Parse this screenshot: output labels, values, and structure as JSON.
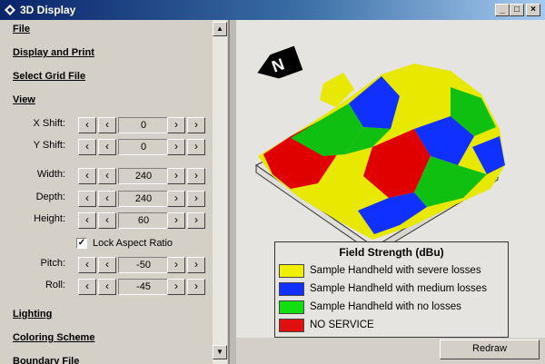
{
  "window": {
    "title": "3D Display",
    "controls": [
      "_",
      "□",
      "×"
    ]
  },
  "sidebar": {
    "sections": {
      "file": "File",
      "display_print": "Display and Print",
      "select_grid": "Select Grid File",
      "view": "View",
      "lighting": "Lighting",
      "coloring": "Coloring Scheme",
      "partial": "Boundary File"
    },
    "controls": [
      {
        "label": "X Shift:",
        "value": "0"
      },
      {
        "label": "Y Shift:",
        "value": "0"
      },
      {
        "label": "Width:",
        "value": "240"
      },
      {
        "label": "Depth:",
        "value": "240"
      },
      {
        "label": "Height:",
        "value": "60"
      },
      {
        "label": "Pitch:",
        "value": "-50"
      },
      {
        "label": "Roll:",
        "value": "-45"
      }
    ],
    "lock_aspect": {
      "label": "Lock Aspect Ratio",
      "checked": true
    }
  },
  "legend": {
    "title": "Field Strength (dBu)",
    "items": [
      {
        "label": "Sample Handheld with severe losses",
        "color": "#f0f000"
      },
      {
        "label": "Sample Handheld with medium losses",
        "color": "#1030ff"
      },
      {
        "label": "Sample Handheld with no losses",
        "color": "#10e010"
      },
      {
        "label": "NO SERVICE",
        "color": "#e01010"
      }
    ]
  },
  "compass": {
    "label": "N"
  },
  "buttons": {
    "redraw": "Redraw"
  }
}
